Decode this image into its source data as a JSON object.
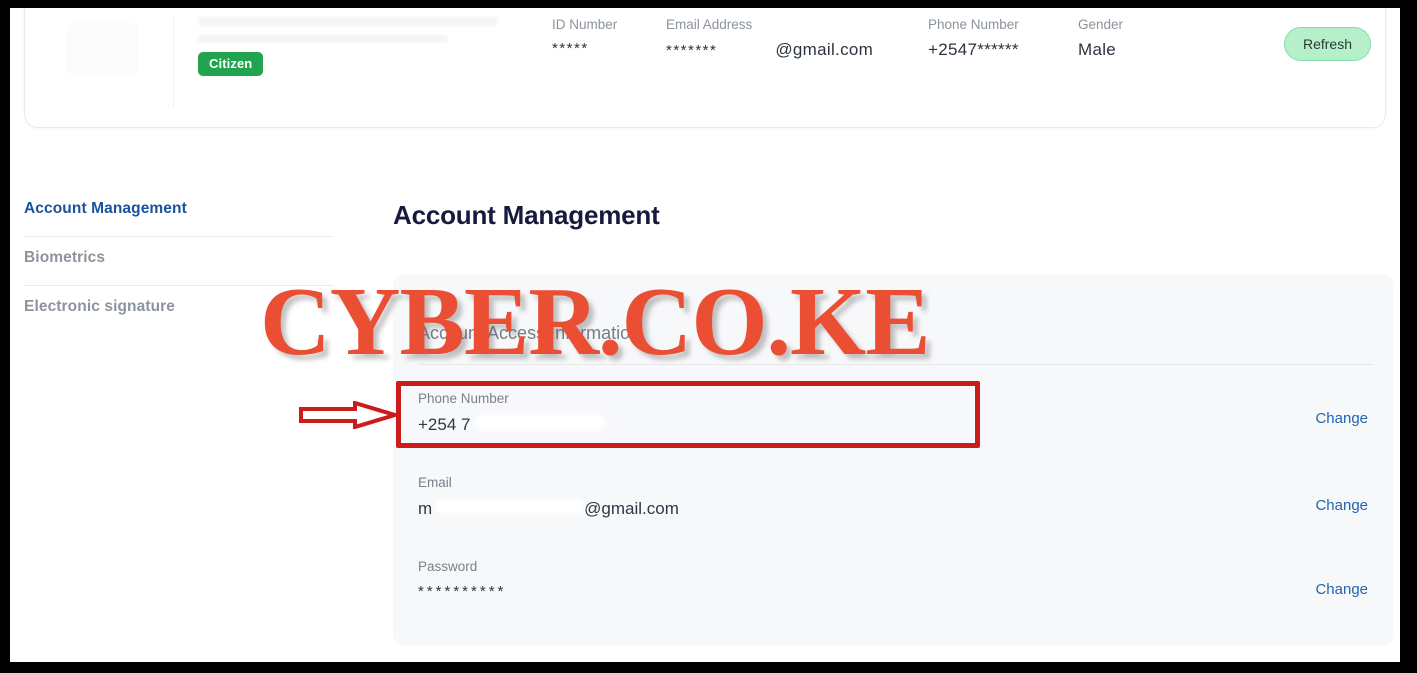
{
  "identity": {
    "badge": "Citizen",
    "refresh_label": "Refresh",
    "fields": [
      {
        "label": "ID Number",
        "value": "*****"
      },
      {
        "label": "Email Address",
        "value": "*******",
        "domain": "@gmail.com"
      },
      {
        "label": "Phone Number",
        "value": "+2547******"
      },
      {
        "label": "Gender",
        "value": "Male"
      }
    ]
  },
  "sidebar": {
    "items": [
      {
        "label": "Account Management"
      },
      {
        "label": "Biometrics"
      },
      {
        "label": "Electronic signature"
      }
    ]
  },
  "main": {
    "title": "Account Management",
    "panel_title": "Account Access Information",
    "rows": [
      {
        "label": "Phone Number",
        "value": "+254 7",
        "action": "Change"
      },
      {
        "label": "Email",
        "value": "m",
        "domain": "@gmail.com",
        "action": "Change"
      },
      {
        "label": "Password",
        "value": "**********",
        "action": "Change"
      }
    ]
  },
  "watermark": {
    "text": "CYBER.CO.KE"
  },
  "colors": {
    "accent_blue": "#18539b",
    "link_blue": "#2164b0",
    "badge_green": "#22a44e",
    "refresh_green": "#b6f0cb",
    "annotation_red": "#cc1b1b",
    "watermark_red": "#ea4f34",
    "title_navy": "#161b3d"
  }
}
